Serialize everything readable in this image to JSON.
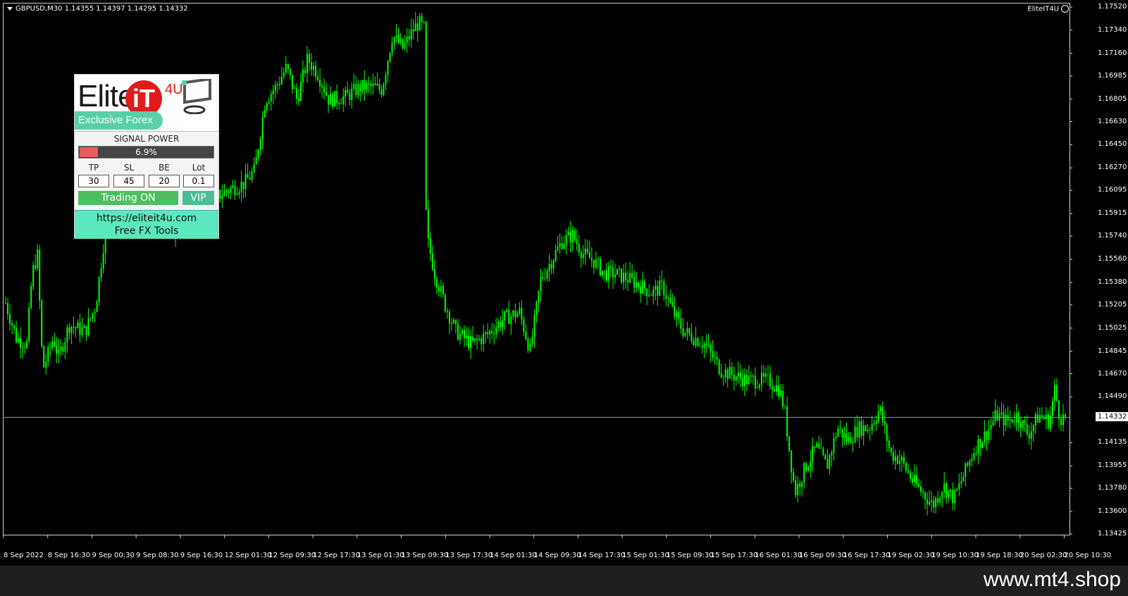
{
  "header": {
    "symbol_info": "GBPUSD,M30  1.14355 1.14397 1.14295 1.14332",
    "ea_name": "EliteIT4U"
  },
  "chart_data": {
    "type": "candlestick",
    "symbol": "GBPUSD",
    "timeframe": "M30",
    "ylim": [
      1.13425,
      1.1752
    ],
    "current_price": 1.14332,
    "current_price_label": "1.14332",
    "y_ticks": [
      "1.17520",
      "1.17340",
      "1.17160",
      "1.16985",
      "1.16805",
      "1.16630",
      "1.16450",
      "1.16270",
      "1.16095",
      "1.15915",
      "1.15740",
      "1.15560",
      "1.15380",
      "1.15205",
      "1.15025",
      "1.14845",
      "1.14670",
      "1.14490",
      "1.14135",
      "1.13955",
      "1.13780",
      "1.13600",
      "1.13425"
    ],
    "x_ticks": [
      "8 Sep 2022",
      "8 Sep 16:30",
      "9 Sep 00:30",
      "9 Sep 08:30",
      "9 Sep 16:30",
      "12 Sep 01:30",
      "12 Sep 09:30",
      "12 Sep 17:30",
      "13 Sep 01:30",
      "13 Sep 09:30",
      "13 Sep 17:30",
      "14 Sep 01:30",
      "14 Sep 09:30",
      "14 Sep 17:30",
      "15 Sep 01:30",
      "15 Sep 09:30",
      "15 Sep 17:30",
      "16 Sep 01:30",
      "16 Sep 09:30",
      "16 Sep 17:30",
      "19 Sep 02:30",
      "19 Sep 10:30",
      "19 Sep 18:30",
      "20 Sep 02:30",
      "20 Sep 10:30"
    ],
    "close_path": [
      [
        0,
        1.1522
      ],
      [
        0.01,
        1.1495
      ],
      [
        0.02,
        1.149
      ],
      [
        0.025,
        1.1545
      ],
      [
        0.03,
        1.156
      ],
      [
        0.035,
        1.147
      ],
      [
        0.045,
        1.1495
      ],
      [
        0.05,
        1.148
      ],
      [
        0.06,
        1.1505
      ],
      [
        0.075,
        1.15
      ],
      [
        0.085,
        1.152
      ],
      [
        0.095,
        1.1585
      ],
      [
        0.105,
        1.161
      ],
      [
        0.115,
        1.165
      ],
      [
        0.13,
        1.164
      ],
      [
        0.145,
        1.1625
      ],
      [
        0.155,
        1.157
      ],
      [
        0.165,
        1.159
      ],
      [
        0.18,
        1.16
      ],
      [
        0.19,
        1.1625
      ],
      [
        0.2,
        1.1605
      ],
      [
        0.21,
        1.161
      ],
      [
        0.225,
        1.1615
      ],
      [
        0.235,
        1.1625
      ],
      [
        0.245,
        1.168
      ],
      [
        0.255,
        1.169
      ],
      [
        0.265,
        1.1705
      ],
      [
        0.275,
        1.168
      ],
      [
        0.285,
        1.1712
      ],
      [
        0.295,
        1.17
      ],
      [
        0.305,
        1.168
      ],
      [
        0.32,
        1.1682
      ],
      [
        0.335,
        1.169
      ],
      [
        0.345,
        1.169
      ],
      [
        0.355,
        1.1688
      ],
      [
        0.365,
        1.173
      ],
      [
        0.375,
        1.172
      ],
      [
        0.385,
        1.1735
      ],
      [
        0.39,
        1.174
      ],
      [
        0.395,
        1.1735
      ],
      [
        0.397,
        1.1575
      ],
      [
        0.405,
        1.1545
      ],
      [
        0.415,
        1.152
      ],
      [
        0.425,
        1.15
      ],
      [
        0.44,
        1.149
      ],
      [
        0.455,
        1.1498
      ],
      [
        0.47,
        1.151
      ],
      [
        0.485,
        1.1515
      ],
      [
        0.495,
        1.1485
      ],
      [
        0.505,
        1.154
      ],
      [
        0.515,
        1.1555
      ],
      [
        0.525,
        1.157
      ],
      [
        0.535,
        1.1575
      ],
      [
        0.545,
        1.156
      ],
      [
        0.555,
        1.1555
      ],
      [
        0.565,
        1.1545
      ],
      [
        0.575,
        1.1545
      ],
      [
        0.59,
        1.154
      ],
      [
        0.6,
        1.1535
      ],
      [
        0.61,
        1.153
      ],
      [
        0.62,
        1.1535
      ],
      [
        0.63,
        1.1515
      ],
      [
        0.64,
        1.15
      ],
      [
        0.65,
        1.1495
      ],
      [
        0.66,
        1.149
      ],
      [
        0.675,
        1.147
      ],
      [
        0.69,
        1.1465
      ],
      [
        0.7,
        1.1462
      ],
      [
        0.71,
        1.1462
      ],
      [
        0.72,
        1.1462
      ],
      [
        0.73,
        1.1455
      ],
      [
        0.735,
        1.144
      ],
      [
        0.74,
        1.1405
      ],
      [
        0.745,
        1.1375
      ],
      [
        0.755,
        1.1395
      ],
      [
        0.765,
        1.141
      ],
      [
        0.775,
        1.1395
      ],
      [
        0.785,
        1.1425
      ],
      [
        0.795,
        1.1415
      ],
      [
        0.805,
        1.1425
      ],
      [
        0.815,
        1.1425
      ],
      [
        0.825,
        1.144
      ],
      [
        0.835,
        1.1405
      ],
      [
        0.845,
        1.14
      ],
      [
        0.855,
        1.1385
      ],
      [
        0.865,
        1.1375
      ],
      [
        0.875,
        1.1365
      ],
      [
        0.885,
        1.138
      ],
      [
        0.895,
        1.137
      ],
      [
        0.905,
        1.139
      ],
      [
        0.915,
        1.141
      ],
      [
        0.925,
        1.142
      ],
      [
        0.935,
        1.1435
      ],
      [
        0.945,
        1.143
      ],
      [
        0.955,
        1.1435
      ],
      [
        0.965,
        1.142
      ],
      [
        0.975,
        1.1435
      ],
      [
        0.985,
        1.143
      ],
      [
        0.99,
        1.1455
      ],
      [
        0.995,
        1.1433
      ],
      [
        1.0,
        1.1433
      ]
    ]
  },
  "panel": {
    "signal_title": "SIGNAL POWER",
    "signal_power": 0.069,
    "signal_power_label": "6.9%",
    "fields": [
      {
        "label": "TP",
        "value": "30"
      },
      {
        "label": "SL",
        "value": "45"
      },
      {
        "label": "BE",
        "value": "20"
      },
      {
        "label": "Lot",
        "value": "0.1"
      }
    ],
    "trading_label": "Trading ON",
    "vip_label": "VIP",
    "footer_url": "https://eliteit4u.com",
    "footer_tools": "Free FX Tools",
    "colors": {
      "trading": "#4cbf5f",
      "vip": "#4dbb96",
      "footer": "#5ce8bf",
      "power_fill": "#ef5a5a",
      "candle": "#00ff00"
    }
  },
  "logo": {
    "word": "Elite",
    "it": "iT",
    "suffix": "4U",
    "tagline": "Exclusive Forex"
  },
  "watermark": "www.mt4.shop"
}
